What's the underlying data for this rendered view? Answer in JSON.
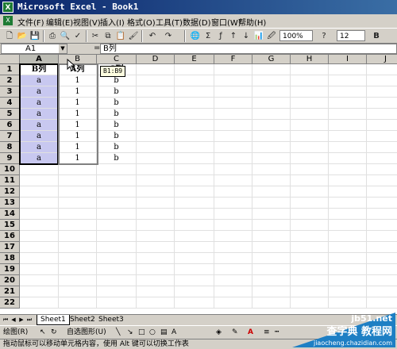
{
  "window": {
    "title": "Microsoft Excel - Book1",
    "app_icon": "X"
  },
  "menu": [
    "文件(F)",
    "编辑(E)",
    "视图(V)",
    "插入(I)",
    "格式(O)",
    "工具(T)",
    "数据(D)",
    "窗口(W)",
    "帮助(H)"
  ],
  "toolbar": {
    "zoom": "100%",
    "font_size": "12",
    "bold": "B",
    "help": "?"
  },
  "formula_bar": {
    "name_box": "A1",
    "fx": "=",
    "content": "B列"
  },
  "columns": [
    "A",
    "B",
    "C",
    "D",
    "E",
    "F",
    "G",
    "H",
    "I",
    "J"
  ],
  "rows": [
    "1",
    "2",
    "3",
    "4",
    "5",
    "6",
    "7",
    "8",
    "9",
    "10",
    "11",
    "12",
    "13",
    "14",
    "15",
    "16",
    "17",
    "18",
    "19",
    "20",
    "21",
    "22"
  ],
  "cells": {
    "A": [
      "B列",
      "a",
      "a",
      "a",
      "a",
      "a",
      "a",
      "a",
      "a"
    ],
    "B": [
      "A列",
      "1",
      "1",
      "1",
      "1",
      "1",
      "1",
      "1",
      "1"
    ],
    "C": [
      "C列",
      "b",
      "b",
      "b",
      "b",
      "b",
      "b",
      "b",
      "b"
    ]
  },
  "drag_tip": "B1:B9",
  "sheets": [
    "Sheet1",
    "Sheet2",
    "Sheet3"
  ],
  "drawing_toolbar": {
    "draw": "绘图(R)",
    "autoshapes": "自选图形(U)"
  },
  "status": "拖动鼠标可以移动单元格内容，使用 Alt 键可以切换工作表",
  "watermark": {
    "line1": "查字典 教程网",
    "line2": "jiaocheng.chazidian.com",
    "site": "jb51.net"
  }
}
